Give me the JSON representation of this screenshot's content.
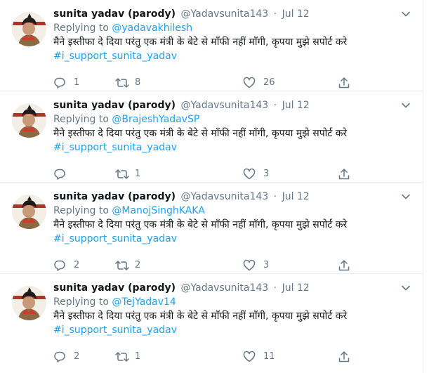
{
  "tweets": [
    {
      "display_name": "sunita yadav (parody)",
      "handle": "@Yadavsunita143",
      "dot": "·",
      "time": "Jul 12",
      "replying_prefix": "Replying to ",
      "replying_to": "@yadavakhilesh",
      "text": "मैने इस्तीफा दे दिया परंतु एक मंत्री के बेटे से माँफी नहीं माँगी, कृपया मुझे सपोर्ट करे",
      "hashtag": "#i_support_sunita_yadav",
      "reply_count": "1",
      "retweet_count": "8",
      "like_count": "26"
    },
    {
      "display_name": "sunita yadav (parody)",
      "handle": "@Yadavsunita143",
      "dot": "·",
      "time": "Jul 12",
      "replying_prefix": "Replying to ",
      "replying_to": "@BrajeshYadavSP",
      "text": "मैने इस्तीफा दे दिया परंतु एक मंत्री के बेटे से माँफी नहीं माँगी, कृपया मुझे सपोर्ट करे",
      "hashtag": "#i_support_sunita_yadav",
      "reply_count": "",
      "retweet_count": "1",
      "like_count": "3"
    },
    {
      "display_name": "sunita yadav (parody)",
      "handle": "@Yadavsunita143",
      "dot": "·",
      "time": "Jul 12",
      "replying_prefix": "Replying to ",
      "replying_to": "@ManojSinghKAKA",
      "text": "मैने इस्तीफा दे दिया परंतु एक मंत्री के बेटे से माँफी नहीं माँगी, कृपया मुझे सपोर्ट करे",
      "hashtag": "#i_support_sunita_yadav",
      "reply_count": "2",
      "retweet_count": "2",
      "like_count": "3"
    },
    {
      "display_name": "sunita yadav (parody)",
      "handle": "@Yadavsunita143",
      "dot": "·",
      "time": "Jul 12",
      "replying_prefix": "Replying to ",
      "replying_to": "@TejYadav14",
      "text": "मैने इस्तीफा दे दिया परंतु एक मंत्री के बेटे से माँफी नहीं माँगी, कृपया मुझे सपोर्ट करे",
      "hashtag": "#i_support_sunita_yadav",
      "reply_count": "2",
      "retweet_count": "1",
      "like_count": "11"
    }
  ],
  "colors": {
    "link": "#1da1f2",
    "secondary_text": "#657786",
    "primary_text": "#14171a",
    "divider": "#e6ecf0"
  },
  "icons": {
    "reply": "reply-icon",
    "retweet": "retweet-icon",
    "like": "heart-icon",
    "share": "share-icon",
    "more": "chevron-down-icon"
  }
}
